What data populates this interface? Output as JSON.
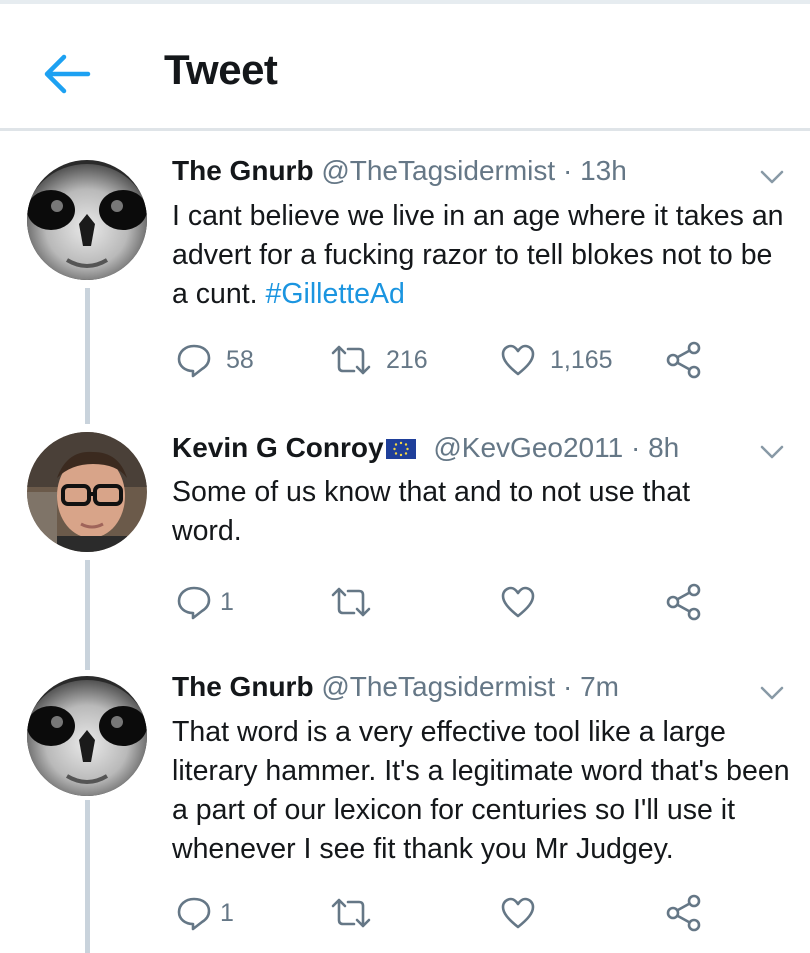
{
  "header": {
    "title": "Tweet",
    "back_icon": "arrow-left-icon",
    "accent": "#1da1f2"
  },
  "tweets": [
    {
      "name": "The Gnurb",
      "handle": "@TheTagsidermist",
      "separator": "·",
      "time": "13h",
      "flag": "",
      "text_plain": "I cant believe we live in an age where it takes an advert for a fucking razor to tell blokes not to be a cunt. ",
      "hashtag": "#GilletteAd",
      "reply_count": "58",
      "retweet_count": "216",
      "like_count": "1,165"
    },
    {
      "name": "Kevin G Conroy",
      "flag": "eu-flag-icon",
      "handle": "@KevGeo2011",
      "separator": "·",
      "time": "8h",
      "text_plain": "Some of us know that and to not use that word.",
      "reply_count": "1",
      "retweet_count": "",
      "like_count": ""
    },
    {
      "name": "The Gnurb",
      "handle": "@TheTagsidermist",
      "separator": "·",
      "time": "7m",
      "flag": "",
      "text_plain": "That word is a very effective tool like a large literary hammer. It's a legitimate word that's been a part of our lexicon for centuries so I'll use it whenever I see fit thank you Mr Judgey.",
      "reply_count": "1",
      "retweet_count": "",
      "like_count": ""
    }
  ],
  "colors": {
    "text": "#14171a",
    "muted": "#657786",
    "link": "#1b95e0",
    "thread": "#c9d3dc"
  }
}
